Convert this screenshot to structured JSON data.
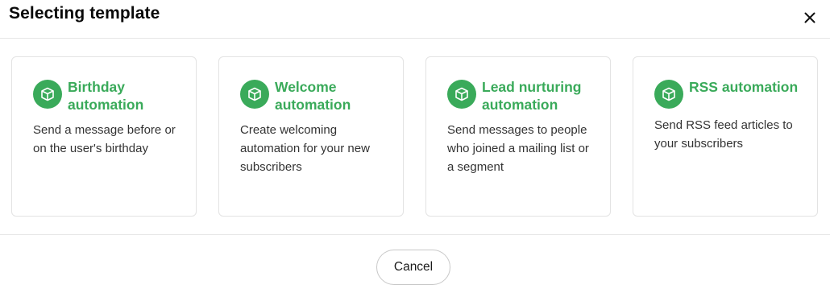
{
  "dialog": {
    "title": "Selecting template",
    "close_icon": "close-icon",
    "accent_color": "#3aaa5a"
  },
  "templates": [
    {
      "icon": "box-icon",
      "title": "Birthday automation",
      "description": "Send a message before or on the user's birthday"
    },
    {
      "icon": "box-icon",
      "title": "Welcome automation",
      "description": "Create welcoming automation for your new subscribers"
    },
    {
      "icon": "box-icon",
      "title": "Lead nurturing automation",
      "description": "Send messages to people who joined a mailing list or a segment"
    },
    {
      "icon": "box-icon",
      "title": "RSS automation",
      "description": "Send RSS feed articles to your subscribers"
    }
  ],
  "footer": {
    "cancel_label": "Cancel"
  }
}
